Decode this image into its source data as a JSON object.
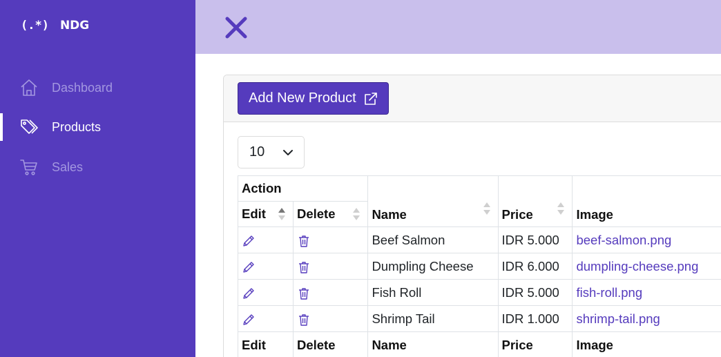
{
  "brand": {
    "logo": "(.*)",
    "name": "NDG"
  },
  "sidebar": {
    "items": [
      {
        "label": "Dashboard",
        "icon": "home-icon",
        "active": false
      },
      {
        "label": "Products",
        "icon": "tag-icon",
        "active": true
      },
      {
        "label": "Sales",
        "icon": "cart-icon",
        "active": false
      }
    ]
  },
  "topbar": {
    "close_icon": "close-icon"
  },
  "toolbar": {
    "add_label": "Add New Product",
    "add_icon": "external-link-icon"
  },
  "length": {
    "value": "10"
  },
  "table": {
    "group_header": "Action",
    "columns": [
      "Edit",
      "Delete",
      "Name",
      "Price",
      "Image"
    ],
    "rows": [
      {
        "name": "Beef Salmon",
        "price": "IDR 5.000",
        "image": "beef-salmon.png"
      },
      {
        "name": "Dumpling Cheese",
        "price": "IDR 6.000",
        "image": "dumpling-cheese.png"
      },
      {
        "name": "Fish Roll",
        "price": "IDR 5.000",
        "image": "fish-roll.png"
      },
      {
        "name": "Shrimp Tail",
        "price": "IDR 1.000",
        "image": "shrimp-tail.png"
      }
    ],
    "footer": [
      "Edit",
      "Delete",
      "Name",
      "Price",
      "Image"
    ]
  },
  "colors": {
    "primary": "#553bbd",
    "topbar": "#c9bfec",
    "sidebar_inactive_text": "#a397e0"
  }
}
